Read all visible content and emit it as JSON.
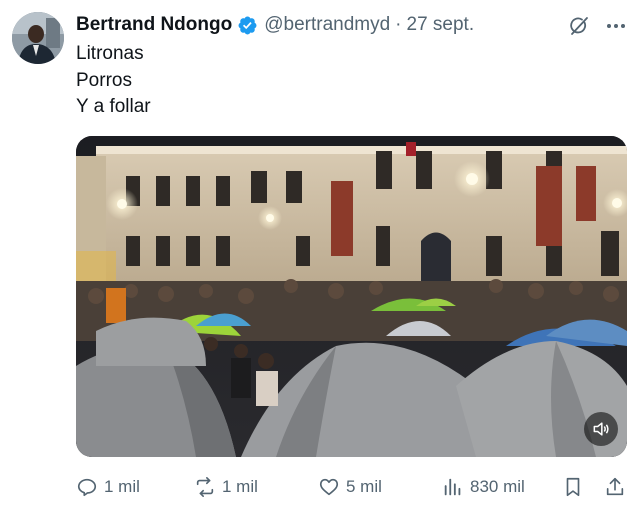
{
  "tweet": {
    "author_name": "Bertrand Ndongo",
    "handle": "@bertrandmyd",
    "separator": "·",
    "date": "27 sept.",
    "verified": true,
    "text_lines": [
      "Litronas",
      "Porros",
      "Y a follar"
    ]
  },
  "media": {
    "type": "video",
    "mute_icon": "speaker-icon"
  },
  "actions": {
    "replies": "1 mil",
    "reposts": "1 mil",
    "likes": "5 mil",
    "views": "830 mil"
  },
  "colors": {
    "text": "#0f1419",
    "secondary": "#536471",
    "verified_badge": "#1d9bf0"
  }
}
